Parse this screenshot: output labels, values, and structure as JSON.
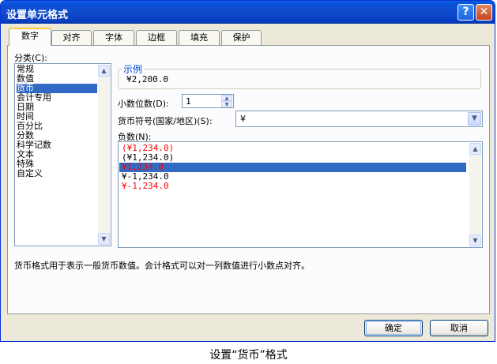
{
  "dialog": {
    "title": "设置单元格式",
    "help_glyph": "?",
    "close_glyph": "✕"
  },
  "tabs": [
    {
      "label": "数字"
    },
    {
      "label": "对齐"
    },
    {
      "label": "字体"
    },
    {
      "label": "边框"
    },
    {
      "label": "填充"
    },
    {
      "label": "保护"
    }
  ],
  "category": {
    "label": "分类(C):",
    "items": [
      "常规",
      "数值",
      "货币",
      "会计专用",
      "日期",
      "时间",
      "百分比",
      "分数",
      "科学记数",
      "文本",
      "特殊",
      "自定义"
    ],
    "selected_index": 2
  },
  "sample": {
    "legend": "示例",
    "value": "¥2,200.0"
  },
  "decimal": {
    "label": "小数位数(D):",
    "value": "1"
  },
  "currency": {
    "label": "货币符号(国家/地区)(S):",
    "value": "¥"
  },
  "negative": {
    "label": "负数(N):",
    "items": [
      {
        "text": "(¥1,234.0)",
        "color": "#ff0000"
      },
      {
        "text": "(¥1,234.0)",
        "color": "#000000"
      },
      {
        "text": "¥1,234.0",
        "color": "#ff0000"
      },
      {
        "text": "¥-1,234.0",
        "color": "#000000"
      },
      {
        "text": "¥-1,234.0",
        "color": "#ff0000"
      }
    ],
    "selected_index": 2
  },
  "description": "货币格式用于表示一般货币数值。会计格式可以对一列数值进行小数点对齐。",
  "buttons": {
    "ok": "确定",
    "cancel": "取消"
  },
  "caption": "设置“货币”格式",
  "colors": {
    "titlebar": "#0a4fd8",
    "selection": "#316ac5",
    "negative_red": "#ff0000",
    "legend_blue": "#0046d5"
  }
}
